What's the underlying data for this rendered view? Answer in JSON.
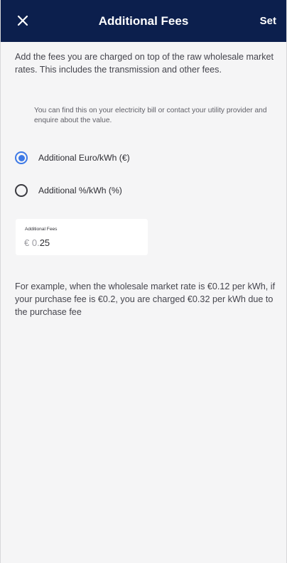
{
  "header": {
    "title": "Additional Fees",
    "set_label": "Set",
    "close_icon": "close-icon",
    "background": "#0c1f4d"
  },
  "intro_text": "Add the fees you are charged on top of the raw wholesale market rates. This includes the transmission and other fees.",
  "hint_text": "You can find this on your electricity bill or contact your utility provider and enquire about the value.",
  "options": [
    {
      "label": "Additional Euro/kWh (€)",
      "selected": true
    },
    {
      "label": "Additional %/kWh (%)",
      "selected": false
    }
  ],
  "fee_field": {
    "label": "Additional Fees",
    "prefix": "€ 0.",
    "value": "25"
  },
  "example_text": "For example, when the wholesale market rate is €0.12 per kWh, if your purchase fee is €0.2, you are charged €0.32 per kWh due to the purchase fee",
  "colors": {
    "accent": "#3d79e6",
    "background": "#f5f5f6"
  }
}
